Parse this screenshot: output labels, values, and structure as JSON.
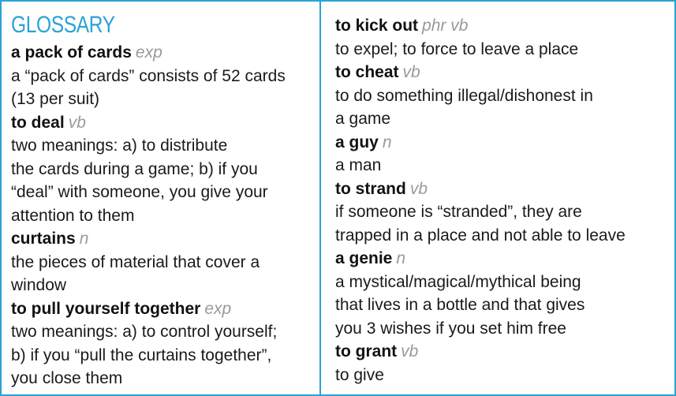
{
  "title": "GLOSSARY",
  "left_entries": [
    {
      "term": "a pack of cards",
      "pos": "exp",
      "definition_lines": [
        "a “pack of cards” consists of 52 cards",
        "(13 per suit)"
      ]
    },
    {
      "term": "to deal",
      "pos": "vb",
      "definition_lines": [
        "two meanings: a) to distribute",
        "the cards during a game; b) if you",
        "“deal” with someone, you give your",
        "attention to them"
      ]
    },
    {
      "term": "curtains",
      "pos": "n",
      "definition_lines": [
        "the pieces of material that cover a",
        "window"
      ]
    },
    {
      "term": "to pull yourself together",
      "pos": "exp",
      "definition_lines": [
        "two meanings: a) to control yourself;",
        "b) if you “pull the curtains together”,",
        "you close them"
      ]
    }
  ],
  "right_entries": [
    {
      "term": "to kick out",
      "pos": "phr vb",
      "definition_lines": [
        "to expel; to force to leave a place"
      ]
    },
    {
      "term": "to cheat",
      "pos": "vb",
      "definition_lines": [
        "to do something illegal/dishonest in",
        "a game"
      ]
    },
    {
      "term": "a guy",
      "pos": "n",
      "definition_lines": [
        "a man"
      ]
    },
    {
      "term": "to strand",
      "pos": "vb",
      "definition_lines": [
        "if someone is “stranded”, they are",
        "trapped in a place and not able to leave"
      ]
    },
    {
      "term": "a genie",
      "pos": "n",
      "definition_lines": [
        "a mystical/magical/mythical being",
        "that lives in a bottle and that gives",
        "you 3 wishes if you set him free"
      ]
    },
    {
      "term": "to grant",
      "pos": "vb",
      "definition_lines": [
        "to give"
      ]
    }
  ]
}
